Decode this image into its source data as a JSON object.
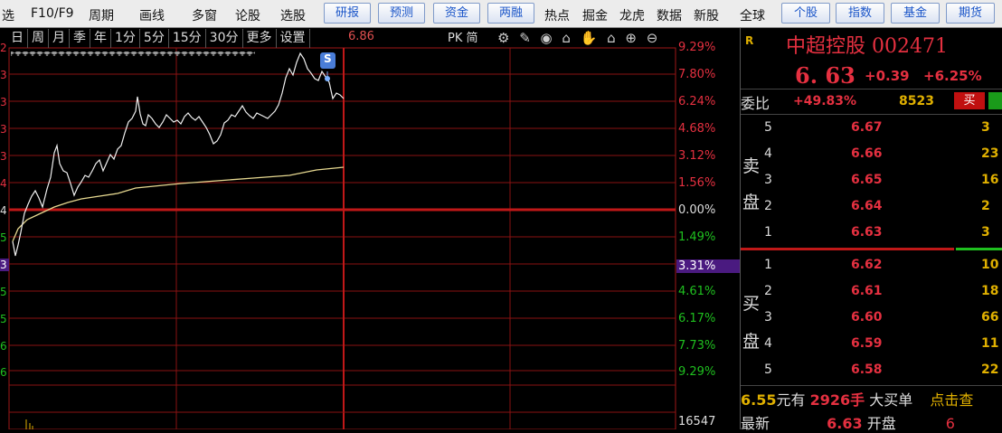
{
  "toolbar": {
    "items": [
      "选",
      "F10/F9",
      "周期",
      "画线",
      "多窗",
      "论股",
      "选股"
    ],
    "buttons": [
      "研报",
      "预测",
      "资金",
      "两融"
    ],
    "items2": [
      "热点",
      "掘金",
      "龙虎",
      "数据",
      "新股",
      "全球"
    ],
    "buttons2": [
      "个股",
      "指数",
      "基金",
      "期货"
    ]
  },
  "periods": [
    "日",
    "周",
    "月",
    "季",
    "年",
    "1分",
    "5分",
    "15分",
    "30分",
    "更多",
    "设置"
  ],
  "price_hint": "6.86",
  "pk_label": "PK",
  "jian_label": "简",
  "tool_icons": "⚙ ✎ ◉ ⌂ ✋ ⌂ ⊕ ⊖",
  "signal_badge": "S",
  "right_axis": [
    "9.29%",
    "7.80%",
    "6.24%",
    "4.68%",
    "3.12%",
    "1.56%",
    "0.00%",
    "1.49%",
    "3.31%",
    "4.61%",
    "6.17%",
    "7.73%",
    "9.29%"
  ],
  "left_axis": [
    "2",
    "3",
    "3",
    "3",
    "3",
    "4",
    "4",
    "5",
    "3",
    "5",
    "5",
    "6",
    "6"
  ],
  "volume_label": "16547",
  "stock": {
    "r_mark": "R",
    "name": "中超控股",
    "code": "002471",
    "price": "6. 63",
    "change": "+0.39",
    "change_pct": "+6.25%"
  },
  "weibi": {
    "label": "委比",
    "value": "+49.83%",
    "num": "8523",
    "buy": "买"
  },
  "sell_label_1": "卖",
  "sell_label_2": "盘",
  "buy_label_1": "买",
  "buy_label_2": "盘",
  "asks": [
    {
      "lvl": "5",
      "price": "6.67",
      "vol": "3"
    },
    {
      "lvl": "4",
      "price": "6.66",
      "vol": "23"
    },
    {
      "lvl": "3",
      "price": "6.65",
      "vol": "16"
    },
    {
      "lvl": "2",
      "price": "6.64",
      "vol": "2"
    },
    {
      "lvl": "1",
      "price": "6.63",
      "vol": "3"
    }
  ],
  "bids": [
    {
      "lvl": "1",
      "price": "6.62",
      "vol": "10"
    },
    {
      "lvl": "2",
      "price": "6.61",
      "vol": "18"
    },
    {
      "lvl": "3",
      "price": "6.60",
      "vol": "66"
    },
    {
      "lvl": "4",
      "price": "6.59",
      "vol": "11"
    },
    {
      "lvl": "5",
      "price": "6.58",
      "vol": "22"
    }
  ],
  "footer": {
    "price": "6.55",
    "yuanyou": "元有",
    "shou": "2926手",
    "big_buy": "大买单",
    "click": "点击查",
    "latest_label": "最新",
    "latest": "6.63",
    "open_label": "开盘",
    "open": "6"
  },
  "colors": {
    "up": "#e53040",
    "down": "#1fc01f",
    "yellow": "#e0b000"
  }
}
